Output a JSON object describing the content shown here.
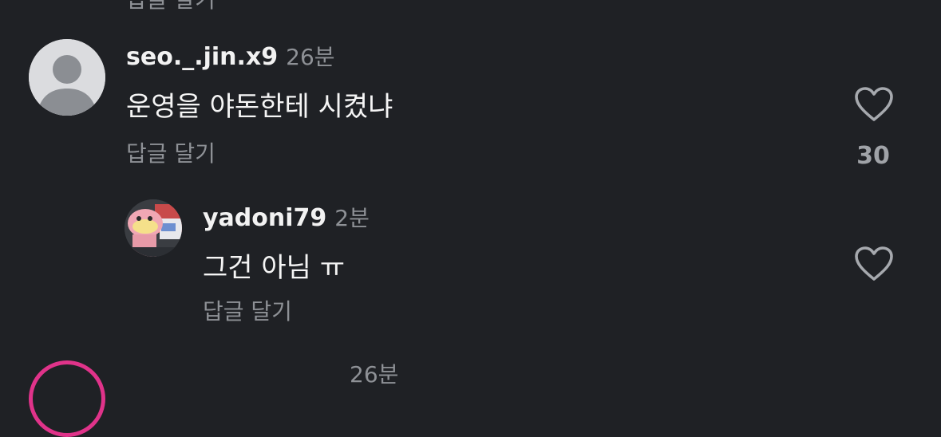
{
  "comments": [
    {
      "username": "seo._.jin.x9",
      "time": "26분",
      "text": "운영을 야돈한테 시켰냐",
      "reply_label": "답글 달기",
      "like_count": "30",
      "avatar_icon": "default-avatar-icon",
      "like_icon": "heart-outline-icon"
    }
  ],
  "replies": [
    {
      "username": "yadoni79",
      "time": "2분",
      "text": "그건 아님 ㅠ",
      "reply_label": "답글 달기",
      "avatar_icon": "slowpoke-avatar-icon",
      "like_icon": "heart-outline-icon"
    }
  ],
  "cut_off_top_text": "답글 달기",
  "cut_off_bottom_time": "26분",
  "colors": {
    "background": "#1f2125",
    "primary_text": "#f5f5f5",
    "secondary_text": "#8e9196",
    "story_ring": "#e0338a"
  }
}
